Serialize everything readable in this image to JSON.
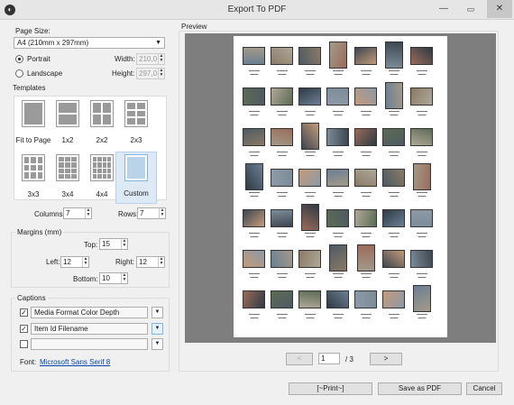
{
  "window": {
    "title": "Export To PDF",
    "minimize": "—",
    "maximize": "▭",
    "close": "✕"
  },
  "page_size": {
    "label": "Page Size:",
    "value": "A4 (210mm x 297mm)",
    "portrait": "Portrait",
    "landscape": "Landscape",
    "width_label": "Width:",
    "width_value": "210,0",
    "height_label": "Height:",
    "height_value": "297,0",
    "orientation_selected": "Portrait"
  },
  "templates": {
    "label": "Templates",
    "items": [
      {
        "label": "Fit to Page"
      },
      {
        "label": "1x2"
      },
      {
        "label": "2x2"
      },
      {
        "label": "2x3"
      },
      {
        "label": "3x3"
      },
      {
        "label": "3x4"
      },
      {
        "label": "4x4"
      },
      {
        "label": "Custom"
      }
    ],
    "selected": "Custom",
    "columns_label": "Columns:",
    "columns_value": "7",
    "rows_label": "Rows:",
    "rows_value": "7"
  },
  "margins": {
    "label": "Margins (mm)",
    "top_label": "Top:",
    "top_value": "15",
    "left_label": "Left:",
    "left_value": "12",
    "right_label": "Right:",
    "right_value": "12",
    "bottom_label": "Bottom:",
    "bottom_value": "10"
  },
  "captions": {
    "label": "Captions",
    "rows": [
      {
        "checked": true,
        "value": "Media Format Color Depth"
      },
      {
        "checked": true,
        "value": "Item Id Filename"
      },
      {
        "checked": false,
        "value": ""
      }
    ],
    "font_label": "Font:",
    "font_value": "Microsoft Sans Serif 8"
  },
  "preview": {
    "label": "Preview",
    "page_current": "1",
    "page_total": "/ 3",
    "prev": "<",
    "next": ">"
  },
  "buttons": {
    "print": "[~Print~]",
    "save": "Save as PDF",
    "cancel": "Cancel"
  },
  "icons": {
    "dropdown": "chevron-down-icon",
    "spin": "spin-arrows-icon",
    "app": "app-logo-icon"
  }
}
